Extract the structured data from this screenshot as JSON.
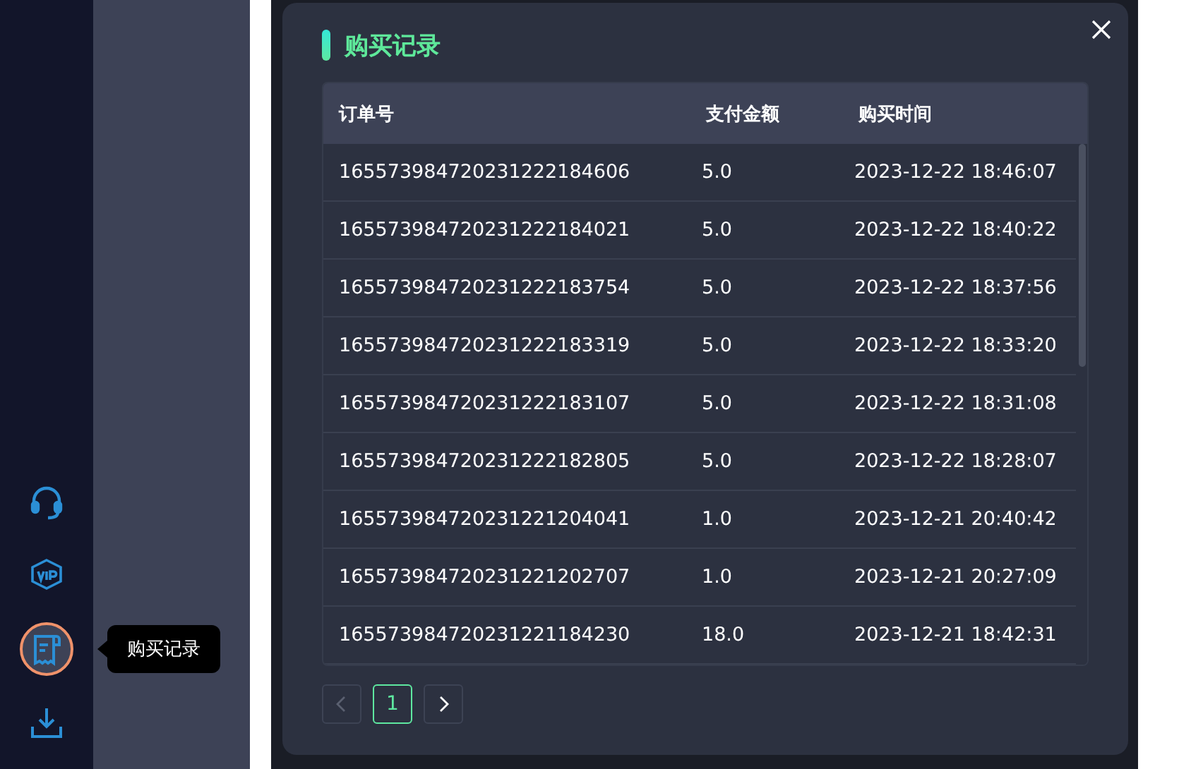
{
  "sidebar": {
    "items": [
      {
        "kind": "support",
        "selected": false
      },
      {
        "kind": "vip",
        "selected": false
      },
      {
        "kind": "orders",
        "selected": true
      },
      {
        "kind": "download",
        "selected": false
      }
    ],
    "tooltip": "购买记录"
  },
  "dialog": {
    "title": "购买记录",
    "table": {
      "columns": [
        "订单号",
        "支付金额",
        "购买时间"
      ],
      "rows": [
        [
          "165573984720231222184606",
          "5.0",
          "2023-12-22 18:46:07"
        ],
        [
          "165573984720231222184021",
          "5.0",
          "2023-12-22 18:40:22"
        ],
        [
          "165573984720231222183754",
          "5.0",
          "2023-12-22 18:37:56"
        ],
        [
          "165573984720231222183319",
          "5.0",
          "2023-12-22 18:33:20"
        ],
        [
          "165573984720231222183107",
          "5.0",
          "2023-12-22 18:31:08"
        ],
        [
          "165573984720231222182805",
          "5.0",
          "2023-12-22 18:28:07"
        ],
        [
          "165573984720231221204041",
          "1.0",
          "2023-12-21 20:40:42"
        ],
        [
          "165573984720231221202707",
          "1.0",
          "2023-12-21 20:27:09"
        ],
        [
          "165573984720231221184230",
          "18.0",
          "2023-12-21 18:42:31"
        ]
      ]
    },
    "pagination": {
      "prev_disabled": true,
      "next_disabled": false,
      "pages": [
        {
          "label": "1",
          "selected": true
        }
      ]
    }
  }
}
